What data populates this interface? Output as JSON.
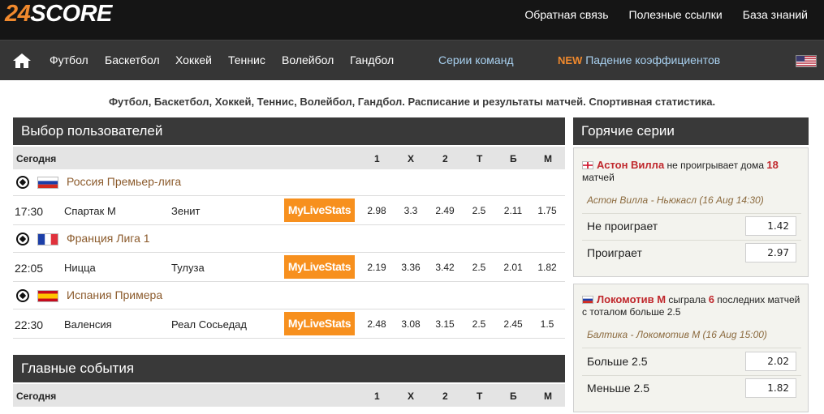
{
  "header": {
    "logo_num": "24",
    "logo_word": "SCORE",
    "links": [
      "Обратная связь",
      "Полезные ссылки",
      "База знаний"
    ]
  },
  "nav": {
    "items": [
      "Футбол",
      "Баскетбол",
      "Хоккей",
      "Теннис",
      "Волейбол",
      "Гандбол"
    ],
    "series": "Серии команд",
    "new_tag": "NEW",
    "odds_drop": "Падение коэффициентов"
  },
  "tagline": "Футбол, Баскетбол, Хоккей, Теннис, Волейбол, Гандбол. Расписание и результаты матчей. Спортивная статистика.",
  "users_choice": {
    "title": "Выбор пользователей",
    "columns": {
      "today": "Сегодня",
      "c1": "1",
      "cx": "X",
      "c2": "2",
      "ct": "T",
      "cb": "Б",
      "cm": "М"
    },
    "leagues": [
      {
        "name": "Россия Премьер-лига",
        "match": {
          "time": "17:30",
          "home": "Спартак М",
          "away": "Зенит",
          "stats": "MyLiveStats",
          "odds": [
            "2.98",
            "3.3",
            "2.49",
            "2.5",
            "2.11",
            "1.75"
          ]
        }
      },
      {
        "name": "Франция Лига 1",
        "match": {
          "time": "22:05",
          "home": "Ницца",
          "away": "Тулуза",
          "stats": "MyLiveStats",
          "odds": [
            "2.19",
            "3.36",
            "3.42",
            "2.5",
            "2.01",
            "1.82"
          ]
        }
      },
      {
        "name": "Испания Примера",
        "match": {
          "time": "22:30",
          "home": "Валенсия",
          "away": "Реал Сосьедад",
          "stats": "MyLiveStats",
          "odds": [
            "2.48",
            "3.08",
            "3.15",
            "2.5",
            "2.45",
            "1.5"
          ]
        }
      }
    ]
  },
  "main_events": {
    "title": "Главные события",
    "columns": {
      "today": "Сегодня",
      "c1": "1",
      "cx": "X",
      "c2": "2",
      "ct": "T",
      "cb": "Б",
      "cm": "М"
    }
  },
  "hot_series": {
    "title": "Горячие серии",
    "cards": [
      {
        "team": "Астон Вилла",
        "text_a": " не проигрывает дома ",
        "num": "18",
        "text_b": " матчей",
        "match": "Астон Вилла - Ньюкасл (16 Aug 14:30)",
        "opt1": "Не проиграет",
        "val1": "1.42",
        "opt2": "Проиграет",
        "val2": "2.97"
      },
      {
        "team": "Локомотив М",
        "text_a": " сыграла ",
        "num": "6",
        "text_b": " последних матчей с тоталом больше 2.5",
        "match": "Балтика - Локомотив М (16 Aug 15:00)",
        "opt1": "Больше 2.5",
        "val1": "2.02",
        "opt2": "Меньше 2.5",
        "val2": "1.82"
      }
    ]
  },
  "colors": {
    "accent": "#f0892d",
    "header_bg": "#151515",
    "nav_bg": "#363636",
    "section_bg": "#393939",
    "link_blue": "#a8d0ef",
    "league_brown": "#8b5a2b",
    "team_red": "#c0282d"
  }
}
